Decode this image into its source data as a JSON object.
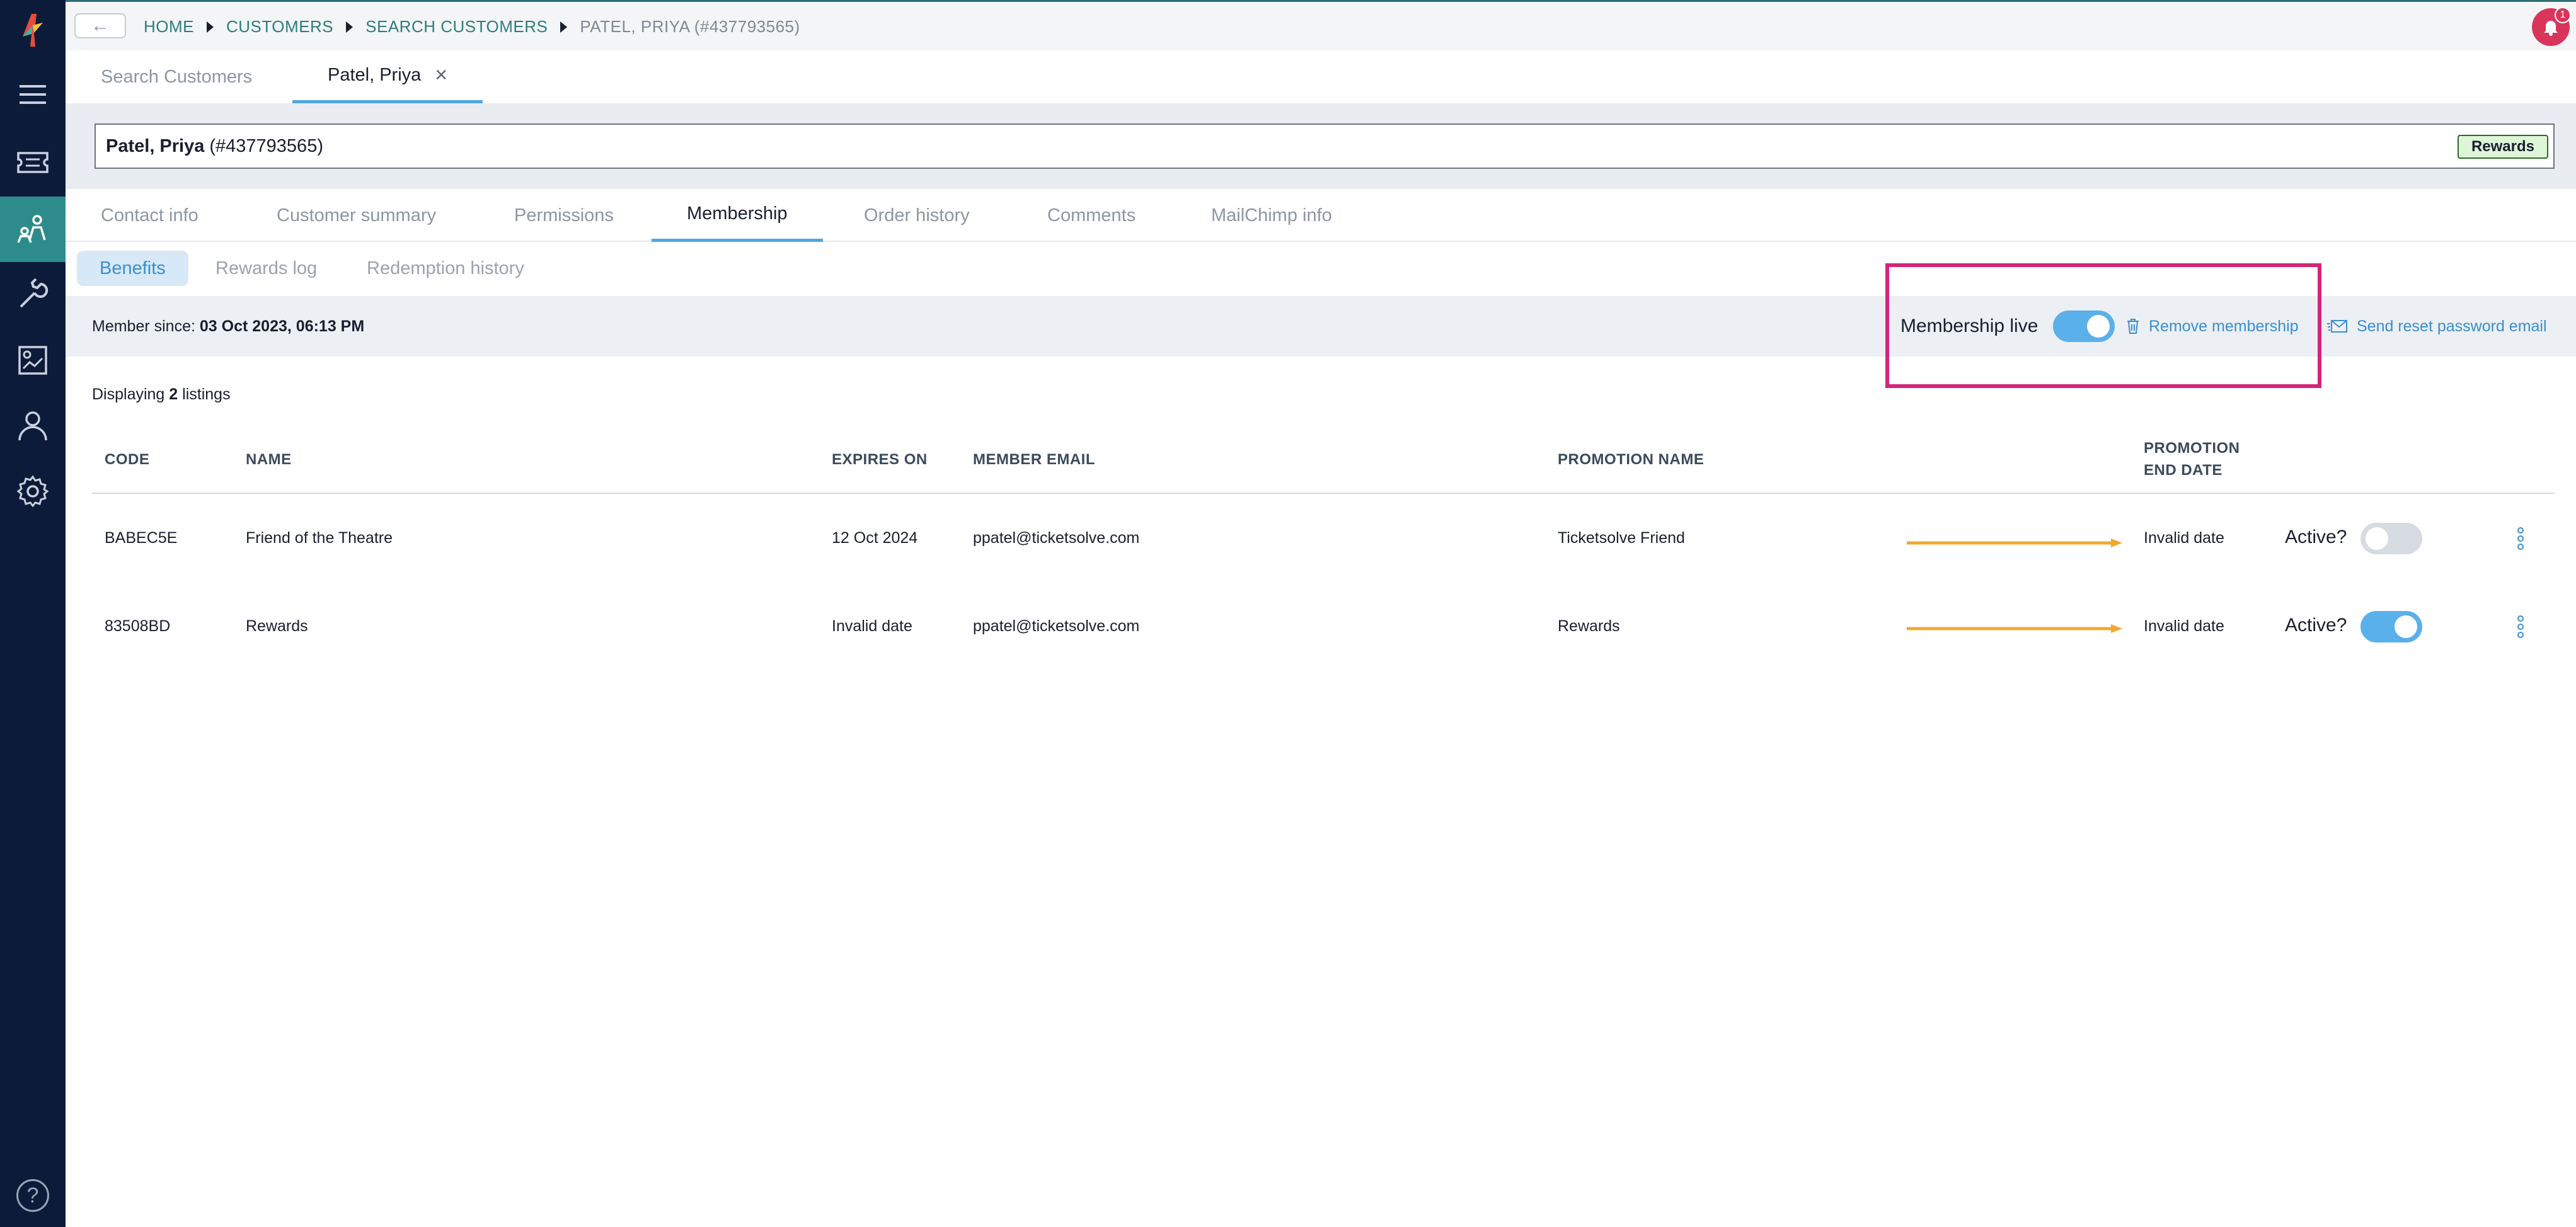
{
  "topbar": {
    "back_label": "←",
    "breadcrumbs": [
      "HOME",
      "CUSTOMERS",
      "SEARCH CUSTOMERS",
      "PATEL, PRIYA (#437793565)"
    ],
    "notification_count": "1"
  },
  "page_tabs": [
    {
      "label": "Search Customers"
    },
    {
      "label": "Patel, Priya",
      "close": "×"
    }
  ],
  "customer": {
    "name": "Patel, Priya",
    "id": "(#437793565)",
    "badge": "Rewards"
  },
  "section_tabs": [
    "Contact info",
    "Customer summary",
    "Permissions",
    "Membership",
    "Order history",
    "Comments",
    "MailChimp info"
  ],
  "sub_tabs": [
    "Benefits",
    "Rewards log",
    "Redemption history"
  ],
  "member_bar": {
    "since_label": "Member since:",
    "since_value": "03 Oct 2023, 06:13 PM",
    "membership_live_label": "Membership live",
    "membership_live": true,
    "remove_label": "Remove membership",
    "reset_label": "Send reset password email"
  },
  "listing": {
    "prefix": "Displaying",
    "count": "2",
    "suffix": "listings"
  },
  "table": {
    "headers": {
      "code": "CODE",
      "name": "NAME",
      "expires": "EXPIRES ON",
      "email": "MEMBER EMAIL",
      "promo": "PROMOTION NAME",
      "promo_end_1": "PROMOTION",
      "promo_end_2": "END DATE"
    },
    "active_label": "Active?",
    "rows": [
      {
        "code": "BABEC5E",
        "name": "Friend of the Theatre",
        "expires": "12 Oct 2024",
        "email": "ppatel@ticketsolve.com",
        "promo": "Ticketsolve Friend",
        "promo_end": "Invalid date",
        "active": false
      },
      {
        "code": "83508BD",
        "name": "Rewards",
        "expires": "Invalid date",
        "email": "ppatel@ticketsolve.com",
        "promo": "Rewards",
        "promo_end": "Invalid date",
        "active": true
      }
    ]
  },
  "colors": {
    "sidebar": "#0d1b3a",
    "sidebar_active": "#2e8b8b",
    "accent": "#4fa7e0",
    "highlight": "#d4247a",
    "arrow": "#f0a830"
  }
}
